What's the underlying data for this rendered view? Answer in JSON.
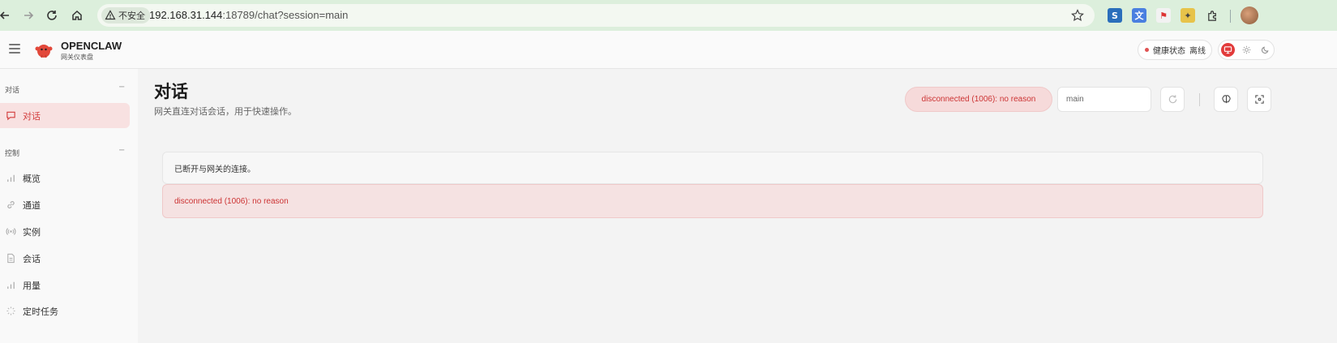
{
  "browser": {
    "security_label": "不安全",
    "url_host": "192.168.31.144",
    "url_rest": ":18789/chat?session=main"
  },
  "header": {
    "brand_title": "OPENCLAW",
    "brand_subtitle": "网关仪表盘",
    "health_label": "健康状态",
    "health_status": "离线"
  },
  "sidebar": {
    "groups": [
      {
        "label": "对话",
        "toggle": "−",
        "items": [
          {
            "label": "对话",
            "icon": "chat-icon",
            "active": true
          }
        ]
      },
      {
        "label": "控制",
        "toggle": "−",
        "items": [
          {
            "label": "概览",
            "icon": "bar-chart-icon"
          },
          {
            "label": "通道",
            "icon": "link-icon"
          },
          {
            "label": "实例",
            "icon": "broadcast-icon"
          },
          {
            "label": "会话",
            "icon": "document-icon"
          },
          {
            "label": "用量",
            "icon": "bar-chart-icon"
          },
          {
            "label": "定时任务",
            "icon": "loader-icon"
          }
        ]
      }
    ]
  },
  "main": {
    "title": "对话",
    "subtitle": "网关直连对话会话，用于快速操作。",
    "status_pill": "disconnected (1006): no reason",
    "session_value": "main",
    "notice": "已断开与网关的连接。",
    "error": "disconnected (1006): no reason"
  },
  "colors": {
    "accent": "#e23b3b",
    "error_bg": "#f5e2e2",
    "error_text": "#cc3333",
    "chrome_bg": "#dcefdc"
  }
}
